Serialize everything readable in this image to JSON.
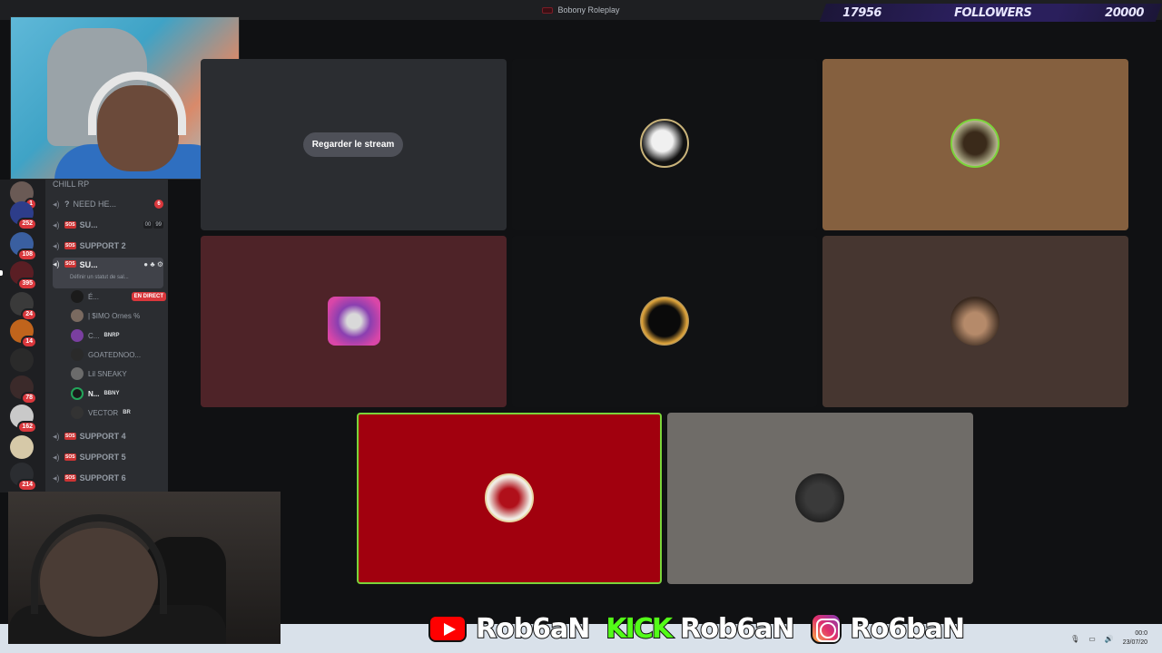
{
  "window": {
    "title": "Bobony Roleplay"
  },
  "followers_bar": {
    "current": "17956",
    "label": "FOLLOWERS",
    "goal": "20000"
  },
  "server_rail": {
    "badges": [
      "1",
      "252",
      "108",
      "395",
      "24",
      "14",
      "78",
      "162",
      "214"
    ]
  },
  "channels": [
    {
      "name": "CHILL RP"
    },
    {
      "name": "NEED HE...",
      "count": "6",
      "prefix": "?"
    },
    {
      "name": "SU...",
      "user_count": "00",
      "limit": "99"
    },
    {
      "name": "SUPPORT 2"
    },
    {
      "name": "SU...",
      "status": "Définir un statut de sal..."
    },
    {
      "name": "SUPPORT 4"
    },
    {
      "name": "SUPPORT 5"
    },
    {
      "name": "SUPPORT 6"
    }
  ],
  "voice_users": [
    {
      "name": "É...",
      "badge": "EN DIRECT"
    },
    {
      "name": "| $IMO Ornes %"
    },
    {
      "name": "C...",
      "tag": "BNRP"
    },
    {
      "name": "GOATEDNOO..."
    },
    {
      "name": "Lil SNEAKY"
    },
    {
      "name": "N...",
      "tag": "BBNY"
    },
    {
      "name": "VECTOR",
      "tag": "BR"
    }
  ],
  "stream_tile": {
    "watch_label": "Regarder le stream"
  },
  "tiles": [
    {
      "bg": "#2b2d31"
    },
    {
      "bg": "#111214"
    },
    {
      "bg": "#85603f"
    },
    {
      "bg": "#4e2328"
    },
    {
      "bg": "#111214"
    },
    {
      "bg": "#463630"
    },
    {
      "bg": "#a1000e"
    },
    {
      "bg": "#6f6c68"
    }
  ],
  "socials": {
    "youtube": "Rob6aN",
    "kick_logo": "KICK",
    "kick": "Rob6aN",
    "instagram": "Ro6baN"
  },
  "taskbar": {
    "time": "00:0",
    "date": "23/07/20"
  }
}
